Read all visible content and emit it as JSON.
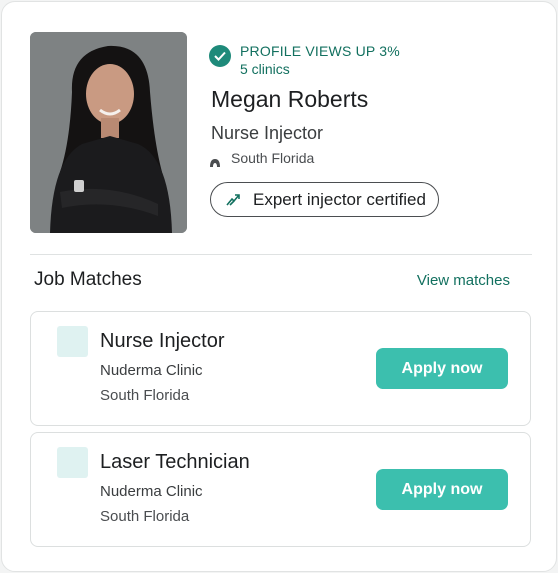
{
  "profile": {
    "status_title": "PROFILE VIEWS UP 3%",
    "status_subtitle": "5 clinics",
    "name": "Megan Roberts",
    "role": "Nurse Injector",
    "location": "South Florida",
    "badge": "Expert injector certified"
  },
  "job_matches": {
    "title": "Job Matches",
    "view_link": "View matches",
    "jobs": [
      {
        "title": "Nurse Injector",
        "company": "Nuderma Clinic",
        "location": "South Florida",
        "apply_label": "Apply now"
      },
      {
        "title": "Laser Technician",
        "company": "Nuderma Clinic",
        "location": "South Florida",
        "apply_label": "Apply now"
      }
    ]
  },
  "colors": {
    "accent": "#3cbfae",
    "accent_dark": "#12705f",
    "logo_tint": "#dff2f1"
  },
  "icons": [
    "check-circle-icon",
    "location-pin-icon",
    "certified-badge-icon",
    "company-logo"
  ]
}
